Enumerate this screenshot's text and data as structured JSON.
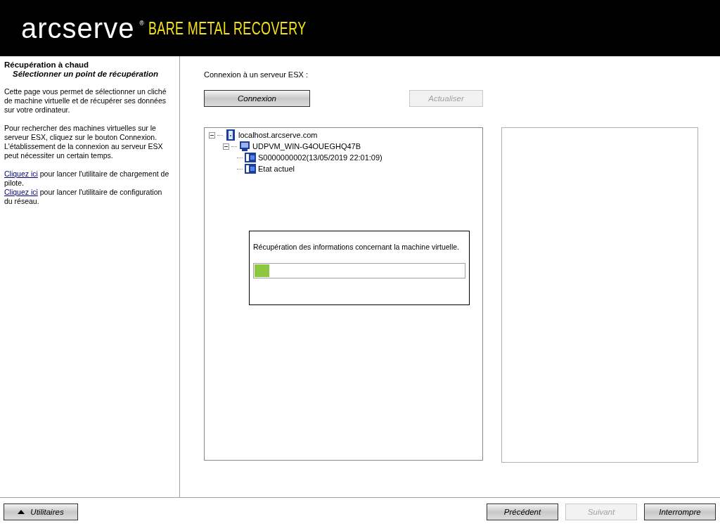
{
  "header": {
    "brand": "arcserve",
    "registered": "®",
    "product": "BARE METAL RECOVERY"
  },
  "sidebar": {
    "title": "Récupération à chaud",
    "subtitle": "Sélectionner un point de récupération",
    "paragraphs": [
      [
        {
          "text": "Cette page vous permet de sélectionner un cliché de machine virtuelle et de récupérer ses données sur votre ordinateur.",
          "link": false
        }
      ],
      [
        {
          "text": "Pour rechercher des machines virtuelles sur le serveur ESX, cliquez sur le bouton Connexion. L'établissement de la connexion au serveur ESX peut nécessiter un certain temps.",
          "link": false
        }
      ],
      [
        {
          "text": "Cliquez ici",
          "link": true
        },
        {
          "text": " pour lancer l'utilitaire de chargement de pilote.",
          "link": false
        }
      ],
      [
        {
          "text": "Cliquez ici",
          "link": true
        },
        {
          "text": " pour lancer l'utilitaire de configuration du réseau.",
          "link": false
        }
      ]
    ]
  },
  "main": {
    "connect_label": "Connexion à un serveur ESX :",
    "connect_button": {
      "label": "Connexion",
      "disabled": false
    },
    "refresh_button": {
      "label": "Actualiser",
      "disabled": true
    },
    "tree": [
      {
        "label": "localhost.arcserve.com",
        "kind": "host",
        "expanded": true,
        "children": [
          {
            "label": "UDPVM_WIN-G4OUEGHQ47B",
            "kind": "vm",
            "expanded": true,
            "children": [
              {
                "label": "S0000000002(13/05/2019 22:01:09)",
                "kind": "snapshot"
              },
              {
                "label": "Etat actuel",
                "kind": "snapshot"
              }
            ]
          }
        ]
      }
    ],
    "progress": {
      "message": "Récupération des informations concernant la machine virtuelle.",
      "level": 0.07
    }
  },
  "footer": {
    "utilities": {
      "label": "Utilitaires"
    },
    "buttons": [
      {
        "label": "Précédent",
        "disabled": false
      },
      {
        "label": "Suivant",
        "disabled": true
      },
      {
        "label": "Interrompre",
        "disabled": false
      }
    ]
  }
}
